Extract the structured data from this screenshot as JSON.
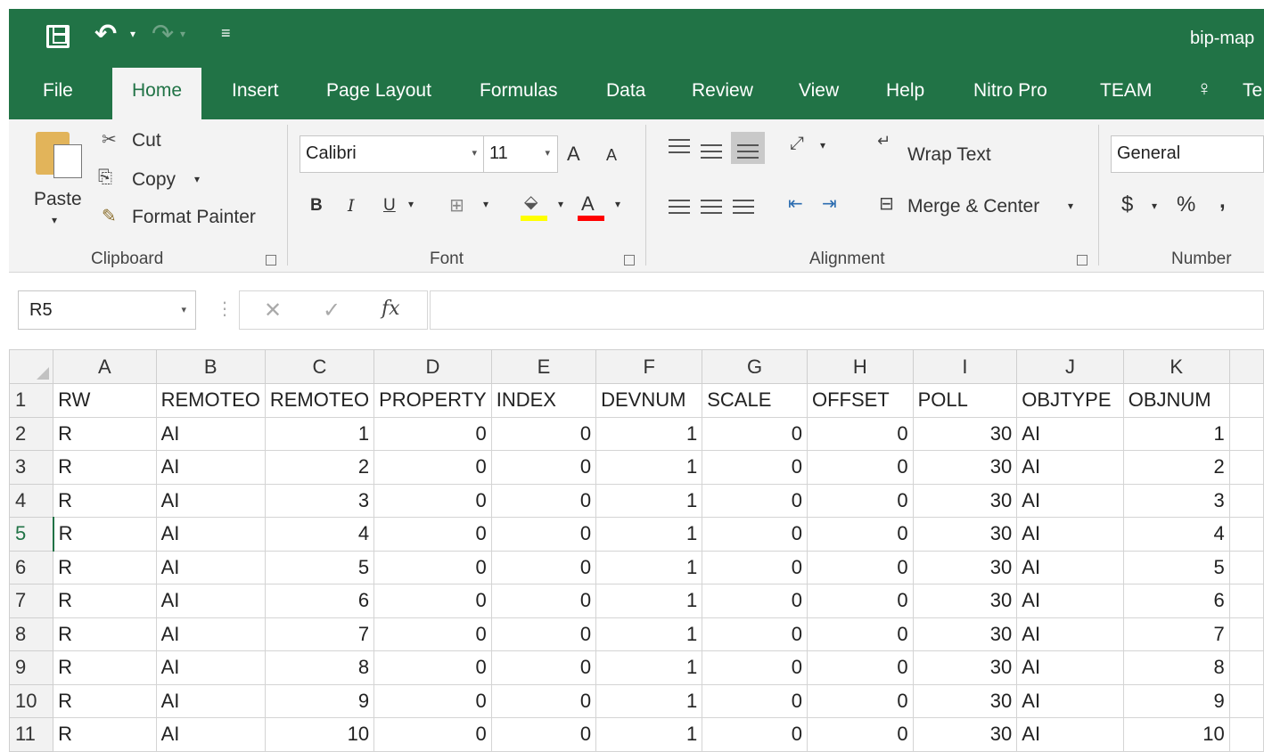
{
  "app": {
    "doc_title": "bip-map"
  },
  "tabs": [
    "File",
    "Home",
    "Insert",
    "Page Layout",
    "Formulas",
    "Data",
    "Review",
    "View",
    "Help",
    "Nitro Pro",
    "TEAM",
    "Te"
  ],
  "ribbon": {
    "clipboard": {
      "paste": "Paste",
      "cut": "Cut",
      "copy": "Copy",
      "format_painter": "Format Painter",
      "label": "Clipboard"
    },
    "font": {
      "name": "Calibri",
      "size": "11",
      "bold": "B",
      "italic": "I",
      "underline": "U",
      "grow": "A",
      "shrink": "A",
      "font_color": "A",
      "label": "Font"
    },
    "alignment": {
      "wrap_text": "Wrap Text",
      "merge_center": "Merge & Center",
      "label": "Alignment"
    },
    "number": {
      "format": "General",
      "currency": "$",
      "percent": "%",
      "comma": ",",
      "label": "Number"
    }
  },
  "formula_bar": {
    "name_box": "R5",
    "fx": "fx",
    "value": ""
  },
  "sheet": {
    "columns": [
      "A",
      "B",
      "C",
      "D",
      "E",
      "F",
      "G",
      "H",
      "I",
      "J",
      "K"
    ],
    "selected_row": 5,
    "rows": [
      [
        "RW",
        "REMOTEO",
        "REMOTEO",
        "PROPERTY",
        "INDEX",
        "DEVNUM",
        "SCALE",
        "OFFSET",
        "POLL",
        "OBJTYPE",
        "OBJNUM"
      ],
      [
        "R",
        "AI",
        "1",
        "0",
        "0",
        "1",
        "0",
        "0",
        "30",
        "AI",
        "1"
      ],
      [
        "R",
        "AI",
        "2",
        "0",
        "0",
        "1",
        "0",
        "0",
        "30",
        "AI",
        "2"
      ],
      [
        "R",
        "AI",
        "3",
        "0",
        "0",
        "1",
        "0",
        "0",
        "30",
        "AI",
        "3"
      ],
      [
        "R",
        "AI",
        "4",
        "0",
        "0",
        "1",
        "0",
        "0",
        "30",
        "AI",
        "4"
      ],
      [
        "R",
        "AI",
        "5",
        "0",
        "0",
        "1",
        "0",
        "0",
        "30",
        "AI",
        "5"
      ],
      [
        "R",
        "AI",
        "6",
        "0",
        "0",
        "1",
        "0",
        "0",
        "30",
        "AI",
        "6"
      ],
      [
        "R",
        "AI",
        "7",
        "0",
        "0",
        "1",
        "0",
        "0",
        "30",
        "AI",
        "7"
      ],
      [
        "R",
        "AI",
        "8",
        "0",
        "0",
        "1",
        "0",
        "0",
        "30",
        "AI",
        "8"
      ],
      [
        "R",
        "AI",
        "9",
        "0",
        "0",
        "1",
        "0",
        "0",
        "30",
        "AI",
        "9"
      ],
      [
        "R",
        "AI",
        "10",
        "0",
        "0",
        "1",
        "0",
        "0",
        "30",
        "AI",
        "10"
      ]
    ]
  },
  "colors": {
    "brand": "#217346",
    "ribbon_bg": "#f3f3f3",
    "highlight_yellow": "#ffff00",
    "font_red": "#ff0000"
  }
}
